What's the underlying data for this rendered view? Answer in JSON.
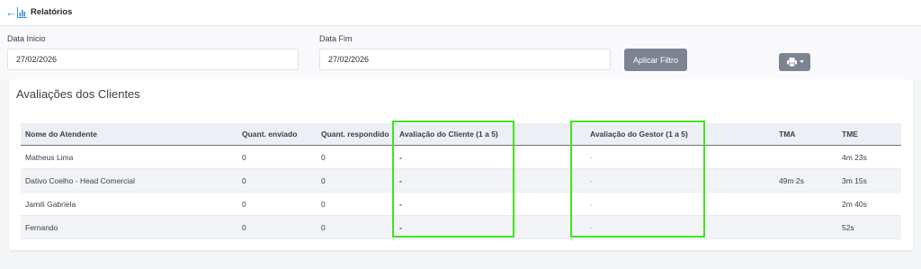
{
  "topbar": {
    "back_icon": "arrow-left-icon",
    "report_icon": "bar-chart-icon",
    "title": "Relatórios"
  },
  "filters": {
    "start_label": "Data Inicio",
    "start_value": "27/02/2026",
    "end_label": "Data Fim",
    "end_value": "27/02/2026",
    "apply_label": "Aplicar Filtro",
    "print_icon": "printer-icon"
  },
  "card": {
    "title": "Avaliações dos Clientes",
    "columns": [
      "Nome do Atendente",
      "Quant. enviado",
      "Quant. respondido",
      "Avaliação do Cliente (1 a 5)",
      "Avaliação do Gestor (1 a 5)",
      "TMA",
      "TME"
    ],
    "rows": [
      {
        "name": "Matheus Lima",
        "sent": "0",
        "answered": "0",
        "client_rating": "-",
        "manager_rating": "-",
        "tma": "",
        "tme": "4m 23s"
      },
      {
        "name": "Dativo Coelho - Head Comercial",
        "sent": "0",
        "answered": "0",
        "client_rating": "-",
        "manager_rating": "-",
        "tma": "49m 2s",
        "tme": "3m 15s"
      },
      {
        "name": "Jamili Gabriela",
        "sent": "0",
        "answered": "0",
        "client_rating": "-",
        "manager_rating": "-",
        "tma": "",
        "tme": "2m 40s"
      },
      {
        "name": "Fernando",
        "sent": "0",
        "answered": "0",
        "client_rating": "-",
        "manager_rating": "-",
        "tma": "",
        "tme": "52s"
      }
    ]
  },
  "colors": {
    "highlight": "#3ee61a",
    "button": "#7c8492",
    "link": "#3f8fd8"
  }
}
